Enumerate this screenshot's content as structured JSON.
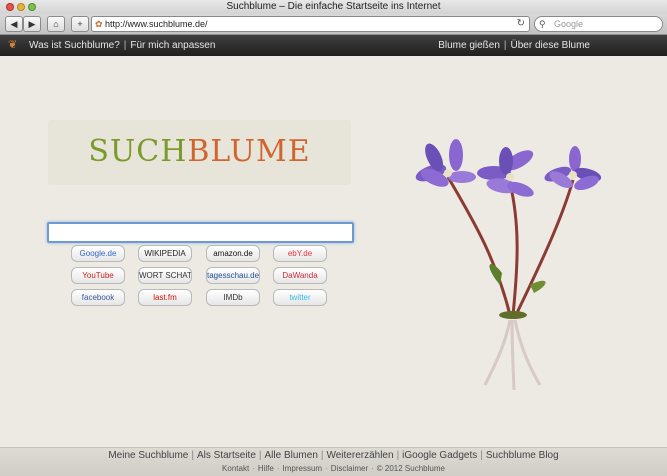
{
  "window": {
    "title": "Suchblume – Die einfache Startseite ins Internet"
  },
  "browser": {
    "url": "http://www.suchblume.de/",
    "search_placeholder": "Google",
    "home_label": "⌂",
    "add_label": "+"
  },
  "nav": {
    "left": [
      "Was ist Suchblume?",
      "Für mich anpassen"
    ],
    "right": [
      "Blume gießen",
      "Über diese Blume"
    ]
  },
  "logo": {
    "part1": "SUCH",
    "part2": "BLUME"
  },
  "quicklinks": [
    {
      "label": "Google.de",
      "color": "#3366cc"
    },
    {
      "label": "WIKIPEDIA",
      "color": "#222222"
    },
    {
      "label": "amazon.de",
      "color": "#111111"
    },
    {
      "label": "ebY.de",
      "color": "#e53238"
    },
    {
      "label": "YouTube",
      "color": "#cc2222"
    },
    {
      "label": "WORT SCHATZ",
      "color": "#333333"
    },
    {
      "label": "tagesschau.de",
      "color": "#1d4f91"
    },
    {
      "label": "DaWanda",
      "color": "#d02a3a"
    },
    {
      "label": "facebook",
      "color": "#3b5998"
    },
    {
      "label": "last.fm",
      "color": "#d51007"
    },
    {
      "label": "IMDb",
      "color": "#333333"
    },
    {
      "label": "twitter",
      "color": "#33bbee"
    }
  ],
  "footer": {
    "line1": [
      "Meine Suchblume",
      "Als Startseite",
      "Alle Blumen",
      "Weitererzählen",
      "iGoogle Gadgets",
      "Suchblume Blog"
    ],
    "line2": [
      "Kontakt",
      "Hilfe",
      "Impressum",
      "Disclaimer",
      "© 2012 Suchblume"
    ]
  }
}
